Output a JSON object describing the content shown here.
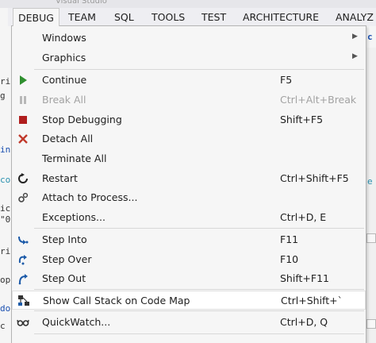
{
  "menubar": {
    "items": [
      "DEBUG",
      "TEAM",
      "SQL",
      "TOOLS",
      "TEST",
      "ARCHITECTURE",
      "ANALYZ"
    ]
  },
  "menu": {
    "windows": "Windows",
    "graphics": "Graphics",
    "continue": {
      "label": "Continue",
      "shortcut": "F5"
    },
    "break_all": {
      "label": "Break All",
      "shortcut": "Ctrl+Alt+Break"
    },
    "stop": {
      "label": "Stop Debugging",
      "shortcut": "Shift+F5"
    },
    "detach": {
      "label": "Detach All"
    },
    "terminate": {
      "label": "Terminate All"
    },
    "restart": {
      "label": "Restart",
      "shortcut": "Ctrl+Shift+F5"
    },
    "attach": {
      "label": "Attach to Process..."
    },
    "exceptions": {
      "label": "Exceptions...",
      "shortcut": "Ctrl+D, E"
    },
    "step_into": {
      "label": "Step Into",
      "shortcut": "F11"
    },
    "step_over": {
      "label": "Step Over",
      "shortcut": "F10"
    },
    "step_out": {
      "label": "Step Out",
      "shortcut": "Shift+F11"
    },
    "show_call_stack": {
      "label": "Show Call Stack on Code Map",
      "shortcut": "Ctrl+Shift+`"
    },
    "quickwatch": {
      "label": "QuickWatch...",
      "shortcut": "Ctrl+D, Q"
    }
  },
  "colors": {
    "continue_green": "#2f8f2f",
    "stop_red": "#b01e1e",
    "detach_red": "#c0392b",
    "step_blue": "#1c5aa8"
  }
}
